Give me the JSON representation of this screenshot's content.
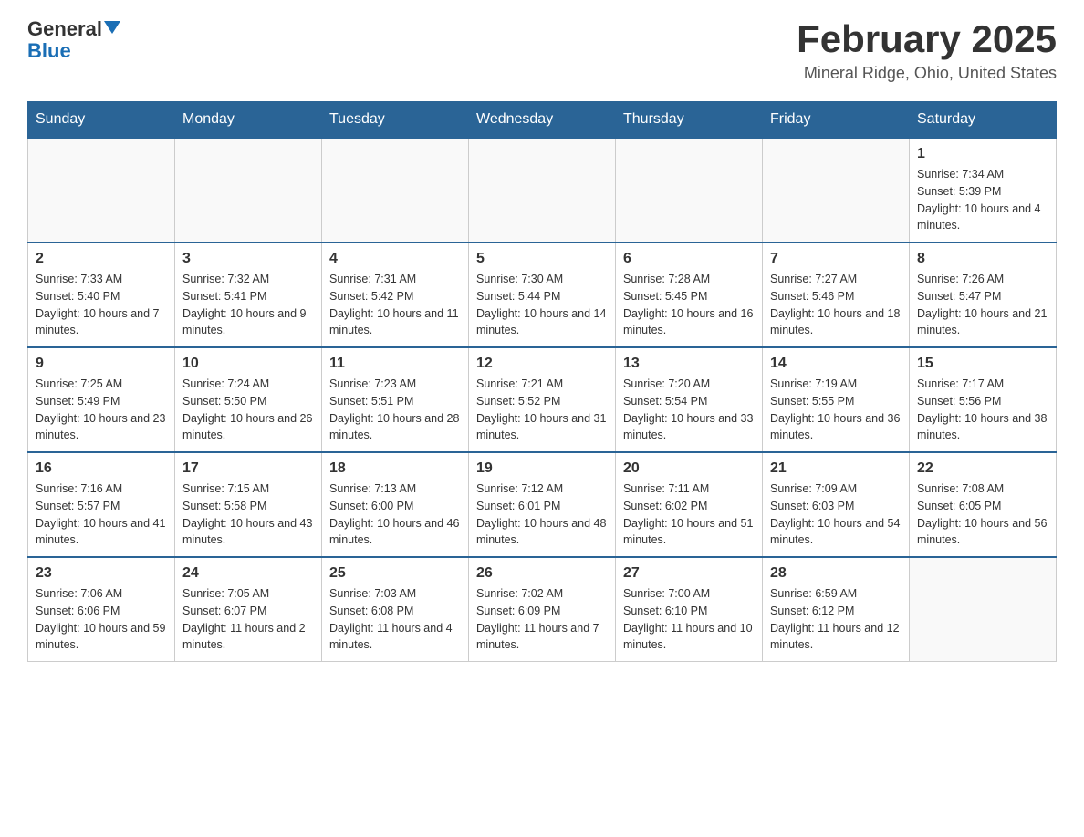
{
  "logo": {
    "general": "General",
    "blue": "Blue"
  },
  "header": {
    "title": "February 2025",
    "location": "Mineral Ridge, Ohio, United States"
  },
  "weekdays": [
    "Sunday",
    "Monday",
    "Tuesday",
    "Wednesday",
    "Thursday",
    "Friday",
    "Saturday"
  ],
  "weeks": [
    [
      {
        "day": "",
        "info": ""
      },
      {
        "day": "",
        "info": ""
      },
      {
        "day": "",
        "info": ""
      },
      {
        "day": "",
        "info": ""
      },
      {
        "day": "",
        "info": ""
      },
      {
        "day": "",
        "info": ""
      },
      {
        "day": "1",
        "info": "Sunrise: 7:34 AM\nSunset: 5:39 PM\nDaylight: 10 hours and 4 minutes."
      }
    ],
    [
      {
        "day": "2",
        "info": "Sunrise: 7:33 AM\nSunset: 5:40 PM\nDaylight: 10 hours and 7 minutes."
      },
      {
        "day": "3",
        "info": "Sunrise: 7:32 AM\nSunset: 5:41 PM\nDaylight: 10 hours and 9 minutes."
      },
      {
        "day": "4",
        "info": "Sunrise: 7:31 AM\nSunset: 5:42 PM\nDaylight: 10 hours and 11 minutes."
      },
      {
        "day": "5",
        "info": "Sunrise: 7:30 AM\nSunset: 5:44 PM\nDaylight: 10 hours and 14 minutes."
      },
      {
        "day": "6",
        "info": "Sunrise: 7:28 AM\nSunset: 5:45 PM\nDaylight: 10 hours and 16 minutes."
      },
      {
        "day": "7",
        "info": "Sunrise: 7:27 AM\nSunset: 5:46 PM\nDaylight: 10 hours and 18 minutes."
      },
      {
        "day": "8",
        "info": "Sunrise: 7:26 AM\nSunset: 5:47 PM\nDaylight: 10 hours and 21 minutes."
      }
    ],
    [
      {
        "day": "9",
        "info": "Sunrise: 7:25 AM\nSunset: 5:49 PM\nDaylight: 10 hours and 23 minutes."
      },
      {
        "day": "10",
        "info": "Sunrise: 7:24 AM\nSunset: 5:50 PM\nDaylight: 10 hours and 26 minutes."
      },
      {
        "day": "11",
        "info": "Sunrise: 7:23 AM\nSunset: 5:51 PM\nDaylight: 10 hours and 28 minutes."
      },
      {
        "day": "12",
        "info": "Sunrise: 7:21 AM\nSunset: 5:52 PM\nDaylight: 10 hours and 31 minutes."
      },
      {
        "day": "13",
        "info": "Sunrise: 7:20 AM\nSunset: 5:54 PM\nDaylight: 10 hours and 33 minutes."
      },
      {
        "day": "14",
        "info": "Sunrise: 7:19 AM\nSunset: 5:55 PM\nDaylight: 10 hours and 36 minutes."
      },
      {
        "day": "15",
        "info": "Sunrise: 7:17 AM\nSunset: 5:56 PM\nDaylight: 10 hours and 38 minutes."
      }
    ],
    [
      {
        "day": "16",
        "info": "Sunrise: 7:16 AM\nSunset: 5:57 PM\nDaylight: 10 hours and 41 minutes."
      },
      {
        "day": "17",
        "info": "Sunrise: 7:15 AM\nSunset: 5:58 PM\nDaylight: 10 hours and 43 minutes."
      },
      {
        "day": "18",
        "info": "Sunrise: 7:13 AM\nSunset: 6:00 PM\nDaylight: 10 hours and 46 minutes."
      },
      {
        "day": "19",
        "info": "Sunrise: 7:12 AM\nSunset: 6:01 PM\nDaylight: 10 hours and 48 minutes."
      },
      {
        "day": "20",
        "info": "Sunrise: 7:11 AM\nSunset: 6:02 PM\nDaylight: 10 hours and 51 minutes."
      },
      {
        "day": "21",
        "info": "Sunrise: 7:09 AM\nSunset: 6:03 PM\nDaylight: 10 hours and 54 minutes."
      },
      {
        "day": "22",
        "info": "Sunrise: 7:08 AM\nSunset: 6:05 PM\nDaylight: 10 hours and 56 minutes."
      }
    ],
    [
      {
        "day": "23",
        "info": "Sunrise: 7:06 AM\nSunset: 6:06 PM\nDaylight: 10 hours and 59 minutes."
      },
      {
        "day": "24",
        "info": "Sunrise: 7:05 AM\nSunset: 6:07 PM\nDaylight: 11 hours and 2 minutes."
      },
      {
        "day": "25",
        "info": "Sunrise: 7:03 AM\nSunset: 6:08 PM\nDaylight: 11 hours and 4 minutes."
      },
      {
        "day": "26",
        "info": "Sunrise: 7:02 AM\nSunset: 6:09 PM\nDaylight: 11 hours and 7 minutes."
      },
      {
        "day": "27",
        "info": "Sunrise: 7:00 AM\nSunset: 6:10 PM\nDaylight: 11 hours and 10 minutes."
      },
      {
        "day": "28",
        "info": "Sunrise: 6:59 AM\nSunset: 6:12 PM\nDaylight: 11 hours and 12 minutes."
      },
      {
        "day": "",
        "info": ""
      }
    ]
  ]
}
